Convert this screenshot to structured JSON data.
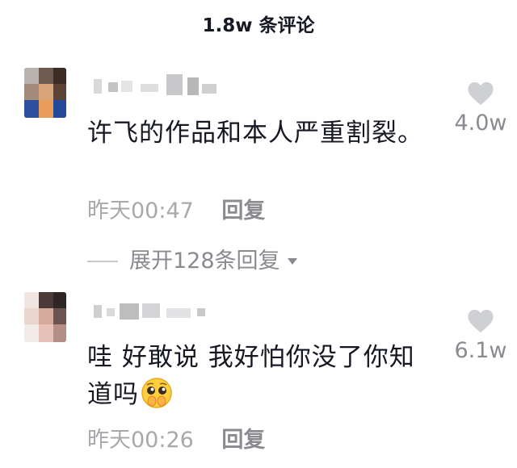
{
  "header": {
    "title": "1.8w 条评论"
  },
  "comments": [
    {
      "text": "许飞的作品和本人严重割裂。",
      "time": "昨天00:47",
      "reply_label": "回复",
      "expand_label": "展开128条回复",
      "likes": "4.0w",
      "icons": {
        "like": "heart-icon",
        "expand": "triangle-down-icon"
      }
    },
    {
      "text": "哇 好敢说 我好怕你没了你知道吗",
      "emoji": "pleading-face-emoji",
      "time": "昨天00:26",
      "reply_label": "回复",
      "likes": "6.1w",
      "icons": {
        "like": "heart-icon"
      }
    }
  ],
  "colors": {
    "text_primary": "#161823",
    "text_secondary": "#8a8b91",
    "timestamp": "#a8a9ad",
    "heart": "#cfd0d3"
  }
}
